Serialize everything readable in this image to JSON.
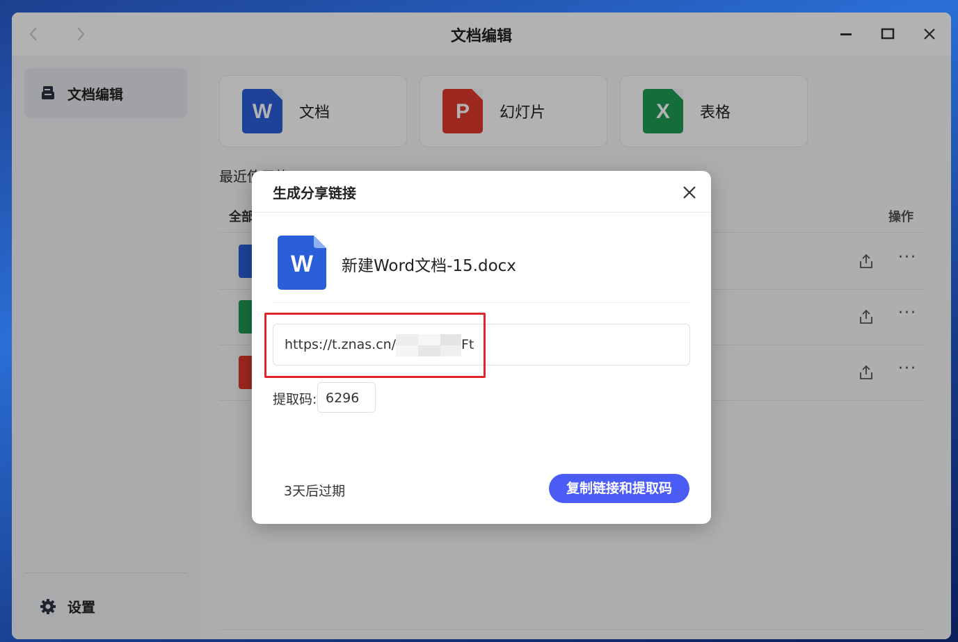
{
  "window": {
    "title": "文档编辑"
  },
  "sidebar": {
    "items": [
      {
        "label": "文档编辑",
        "icon": "document-edit-icon"
      }
    ],
    "settings_label": "设置"
  },
  "cards": [
    {
      "label": "文档",
      "icon_letter": "W",
      "color": "#2b5fd9"
    },
    {
      "label": "幻灯片",
      "icon_letter": "P",
      "color": "#e03a2f"
    },
    {
      "label": "表格",
      "icon_letter": "X",
      "color": "#1f9d55"
    }
  ],
  "recent": {
    "heading": "最近使用的",
    "header_all": "全部",
    "header_ops": "操作"
  },
  "dialog": {
    "title": "生成分享链接",
    "file_name": "新建Word文档-15.docx",
    "file_icon_letter": "W",
    "link_prefix": "https://t.znas.cn/",
    "link_suffix": "Ft",
    "code_label": "提取码:",
    "code_value": "6296",
    "expire_text": "3天后过期",
    "copy_button": "复制链接和提取码"
  },
  "colors": {
    "accent": "#4b5cf5",
    "highlight_box": "#e0252b"
  }
}
